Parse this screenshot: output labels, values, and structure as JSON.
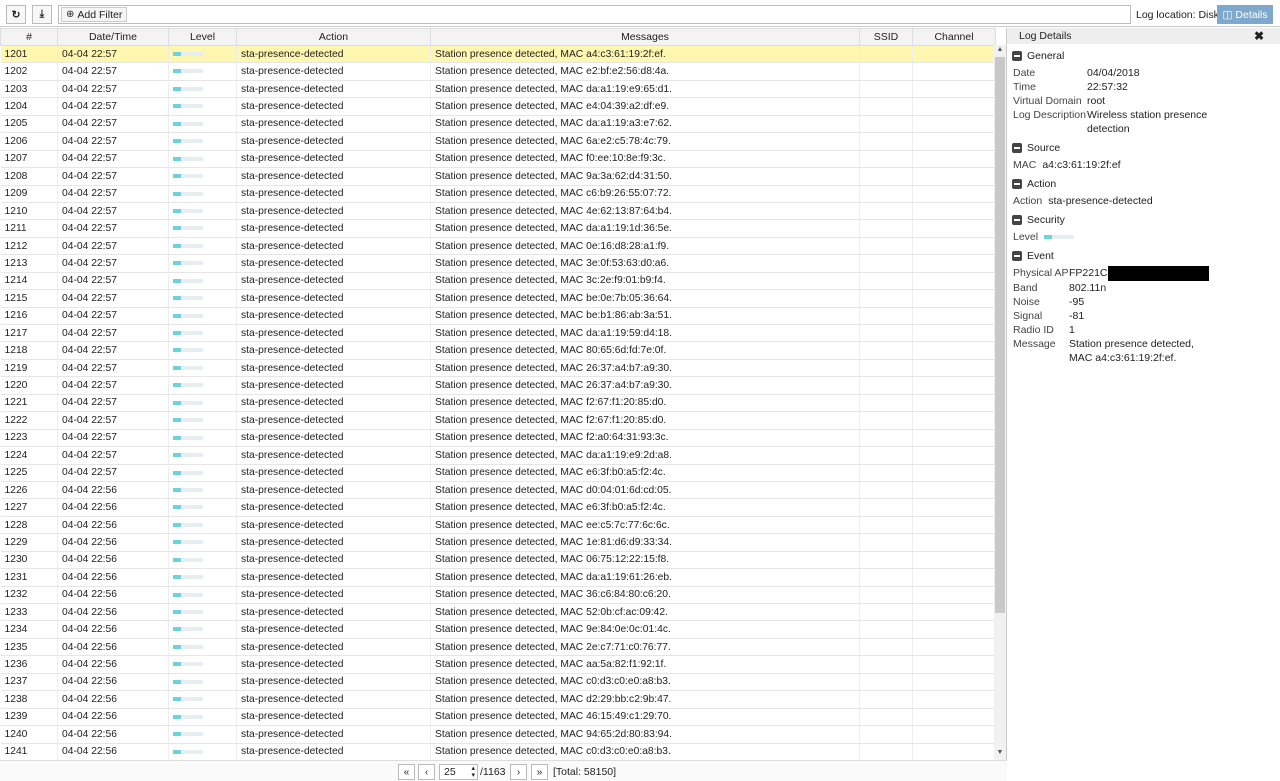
{
  "toolbar": {
    "add_filter": "Add Filter",
    "log_location": "Log location: Disk",
    "details": "Details"
  },
  "columns": [
    "#",
    "Date/Time",
    "Level",
    "Action",
    "Messages",
    "SSID",
    "Channel"
  ],
  "level_fraction": 0.25,
  "rows": [
    [
      "1201",
      "04-04 22:57",
      "sta-presence-detected",
      "Station presence detected, MAC a4:c3:61:19:2f:ef."
    ],
    [
      "1202",
      "04-04 22:57",
      "sta-presence-detected",
      "Station presence detected, MAC e2:bf:e2:56:d8:4a."
    ],
    [
      "1203",
      "04-04 22:57",
      "sta-presence-detected",
      "Station presence detected, MAC da:a1:19:e9:65:d1."
    ],
    [
      "1204",
      "04-04 22:57",
      "sta-presence-detected",
      "Station presence detected, MAC e4:04:39:a2:df:e9."
    ],
    [
      "1205",
      "04-04 22:57",
      "sta-presence-detected",
      "Station presence detected, MAC da:a1:19:a3:e7:62."
    ],
    [
      "1206",
      "04-04 22:57",
      "sta-presence-detected",
      "Station presence detected, MAC 6a:e2:c5:78:4c:79."
    ],
    [
      "1207",
      "04-04 22:57",
      "sta-presence-detected",
      "Station presence detected, MAC f0:ee:10:8e:f9:3c."
    ],
    [
      "1208",
      "04-04 22:57",
      "sta-presence-detected",
      "Station presence detected, MAC 9a:3a:62:d4:31:50."
    ],
    [
      "1209",
      "04-04 22:57",
      "sta-presence-detected",
      "Station presence detected, MAC c6:b9:26:55:07:72."
    ],
    [
      "1210",
      "04-04 22:57",
      "sta-presence-detected",
      "Station presence detected, MAC 4e:62:13:87:64:b4."
    ],
    [
      "1211",
      "04-04 22:57",
      "sta-presence-detected",
      "Station presence detected, MAC da:a1:19:1d:36:5e."
    ],
    [
      "1212",
      "04-04 22:57",
      "sta-presence-detected",
      "Station presence detected, MAC 0e:16:d8:28:a1:f9."
    ],
    [
      "1213",
      "04-04 22:57",
      "sta-presence-detected",
      "Station presence detected, MAC 3e:0f:53:63:d0:a6."
    ],
    [
      "1214",
      "04-04 22:57",
      "sta-presence-detected",
      "Station presence detected, MAC 3c:2e:f9:01:b9:f4."
    ],
    [
      "1215",
      "04-04 22:57",
      "sta-presence-detected",
      "Station presence detected, MAC be:0e:7b:05:36:64."
    ],
    [
      "1216",
      "04-04 22:57",
      "sta-presence-detected",
      "Station presence detected, MAC be:b1:86:ab:3a:51."
    ],
    [
      "1217",
      "04-04 22:57",
      "sta-presence-detected",
      "Station presence detected, MAC da:a1:19:59:d4:18."
    ],
    [
      "1218",
      "04-04 22:57",
      "sta-presence-detected",
      "Station presence detected, MAC 80:65:6d:fd:7e:0f."
    ],
    [
      "1219",
      "04-04 22:57",
      "sta-presence-detected",
      "Station presence detected, MAC 26:37:a4:b7:a9:30."
    ],
    [
      "1220",
      "04-04 22:57",
      "sta-presence-detected",
      "Station presence detected, MAC 26:37:a4:b7:a9:30."
    ],
    [
      "1221",
      "04-04 22:57",
      "sta-presence-detected",
      "Station presence detected, MAC f2:67:f1:20:85:d0."
    ],
    [
      "1222",
      "04-04 22:57",
      "sta-presence-detected",
      "Station presence detected, MAC f2:67:f1:20:85:d0."
    ],
    [
      "1223",
      "04-04 22:57",
      "sta-presence-detected",
      "Station presence detected, MAC f2:a0:64:31:93:3c."
    ],
    [
      "1224",
      "04-04 22:57",
      "sta-presence-detected",
      "Station presence detected, MAC da:a1:19:e9:2d:a8."
    ],
    [
      "1225",
      "04-04 22:57",
      "sta-presence-detected",
      "Station presence detected, MAC e6:3f:b0:a5:f2:4c."
    ],
    [
      "1226",
      "04-04 22:56",
      "sta-presence-detected",
      "Station presence detected, MAC d0:04:01:6d:cd:05."
    ],
    [
      "1227",
      "04-04 22:56",
      "sta-presence-detected",
      "Station presence detected, MAC e6:3f:b0:a5:f2:4c."
    ],
    [
      "1228",
      "04-04 22:56",
      "sta-presence-detected",
      "Station presence detected, MAC ee:c5:7c:77:6c:6c."
    ],
    [
      "1229",
      "04-04 22:56",
      "sta-presence-detected",
      "Station presence detected, MAC 1e:81:d6:d9:33:34."
    ],
    [
      "1230",
      "04-04 22:56",
      "sta-presence-detected",
      "Station presence detected, MAC 06:75:12:22:15:f8."
    ],
    [
      "1231",
      "04-04 22:56",
      "sta-presence-detected",
      "Station presence detected, MAC da:a1:19:61:26:eb."
    ],
    [
      "1232",
      "04-04 22:56",
      "sta-presence-detected",
      "Station presence detected, MAC 36:c6:84:80:c6:20."
    ],
    [
      "1233",
      "04-04 22:56",
      "sta-presence-detected",
      "Station presence detected, MAC 52:0b:cf:ac:09:42."
    ],
    [
      "1234",
      "04-04 22:56",
      "sta-presence-detected",
      "Station presence detected, MAC 9e:84:0e:0c:01:4c."
    ],
    [
      "1235",
      "04-04 22:56",
      "sta-presence-detected",
      "Station presence detected, MAC 2e:c7:71:c0:76:77."
    ],
    [
      "1236",
      "04-04 22:56",
      "sta-presence-detected",
      "Station presence detected, MAC aa:5a:82:f1:92:1f."
    ],
    [
      "1237",
      "04-04 22:56",
      "sta-presence-detected",
      "Station presence detected, MAC c0:d3:c0:e0:a8:b3."
    ],
    [
      "1238",
      "04-04 22:56",
      "sta-presence-detected",
      "Station presence detected, MAC d2:29:bb:c2:9b:47."
    ],
    [
      "1239",
      "04-04 22:56",
      "sta-presence-detected",
      "Station presence detected, MAC 46:15:49:c1:29:70."
    ],
    [
      "1240",
      "04-04 22:56",
      "sta-presence-detected",
      "Station presence detected, MAC 94:65:2d:80:83:94."
    ],
    [
      "1241",
      "04-04 22:56",
      "sta-presence-detected",
      "Station presence detected, MAC c0:d3:c0:e0:a8:b3."
    ]
  ],
  "pager": {
    "page": "25",
    "total_pages": "/1163",
    "total": "[Total: 58150]"
  },
  "panel": {
    "title": "Log Details",
    "general": {
      "title": "General",
      "items": [
        [
          "Date",
          "04/04/2018"
        ],
        [
          "Time",
          "22:57:32"
        ],
        [
          "Virtual Domain",
          "root"
        ],
        [
          "Log Description",
          "Wireless station presence detection"
        ]
      ]
    },
    "source": {
      "title": "Source",
      "label": "MAC",
      "value": "a4:c3:61:19:2f:ef"
    },
    "action": {
      "title": "Action",
      "label": "Action",
      "value": "sta-presence-detected"
    },
    "security": {
      "title": "Security",
      "label": "Level"
    },
    "event": {
      "title": "Event",
      "items": [
        [
          "Physical AP",
          "FP221C"
        ],
        [
          "Band",
          "802.11n"
        ],
        [
          "Noise",
          "-95"
        ],
        [
          "Signal",
          "-81"
        ],
        [
          "Radio ID",
          "1"
        ],
        [
          "Message",
          "Station presence detected, MAC a4:c3:61:19:2f:ef."
        ]
      ]
    }
  }
}
